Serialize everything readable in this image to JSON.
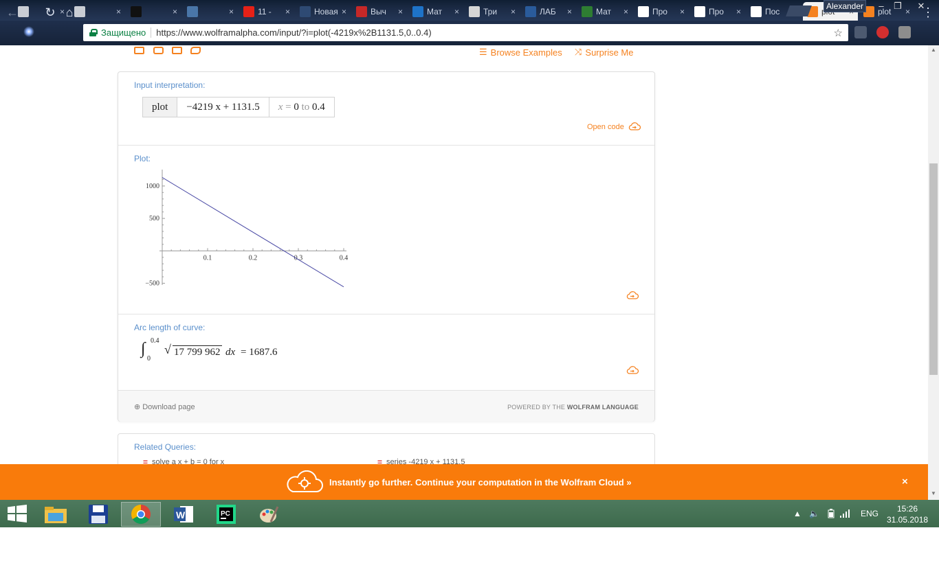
{
  "browser": {
    "tabs": [
      {
        "title": "",
        "color": "#c9cdd4"
      },
      {
        "title": "",
        "color": "#c9cdd4"
      },
      {
        "title": "",
        "color": "#111111"
      },
      {
        "title": "",
        "color": "#4a76a8"
      },
      {
        "title": "11 -",
        "color": "#e62117"
      },
      {
        "title": "Новая в",
        "color": "#2e4a73"
      },
      {
        "title": "Выч",
        "color": "#c62828"
      },
      {
        "title": "Мат",
        "color": "#1e73c8"
      },
      {
        "title": "Три",
        "color": "#d6d6d6"
      },
      {
        "title": "ЛАБ",
        "color": "#2a5b9b"
      },
      {
        "title": "Мат",
        "color": "#2e7d32"
      },
      {
        "title": "Про",
        "color": "#ffffff"
      },
      {
        "title": "Про",
        "color": "#ffffff"
      },
      {
        "title": "Пос",
        "color": "#ffffff"
      },
      {
        "title": "plot",
        "color": "#f58220"
      },
      {
        "title": "plot",
        "color": "#f58220"
      }
    ],
    "user": "Alexander",
    "secure_label": "Защищено",
    "url": "https://www.wolframalpha.com/input/?i=plot(-4219x%2B1131.5,0..0.4)"
  },
  "toolbar": {
    "browse_examples": "Browse Examples",
    "surprise_me": "Surprise Me"
  },
  "input_pod": {
    "title": "Input interpretation:",
    "head": "plot",
    "expr": "−4219 x + 1131.5",
    "range_var": "x",
    "range_eq": "=",
    "range_from": "0",
    "range_to_word": "to",
    "range_to": "0.4",
    "open_code": "Open code"
  },
  "plot_pod": {
    "title": "Plot:"
  },
  "chart_data": {
    "type": "line",
    "title": "",
    "xlabel": "",
    "ylabel": "",
    "xlim": [
      0,
      0.4
    ],
    "ylim": [
      -600,
      1200
    ],
    "x_ticks": [
      0.1,
      0.2,
      0.3,
      0.4
    ],
    "y_ticks": [
      1000,
      500,
      -500
    ],
    "x_tick_labels": [
      "0.1",
      "0.2",
      "0.3",
      "0.4"
    ],
    "y_tick_labels": [
      "1000",
      "500",
      "−500"
    ],
    "series": [
      {
        "x": [
          0,
          0.4
        ],
        "y": [
          1131.5,
          -556.1
        ],
        "color": "#4a4aa5"
      }
    ],
    "grid": false
  },
  "arc_pod": {
    "title": "Arc length of curve:",
    "upper": "0.4",
    "lower": "0",
    "radicand": "17 799 962",
    "dx": "dx",
    "result": "= 1687.6"
  },
  "footer": {
    "download": "Download page",
    "powered_prefix": "POWERED BY THE",
    "powered_brand": "WOLFRAM LANGUAGE"
  },
  "related": {
    "title": "Related Queries:",
    "items": [
      "solve a x + b = 0 for x",
      "series -4219 x + 1131.5"
    ]
  },
  "banner": {
    "text": "Instantly go further. Continue your computation in the Wolfram Cloud »",
    "close": "×"
  },
  "taskbar": {
    "lang": "ENG",
    "time": "15:26",
    "date": "31.05.2018"
  },
  "colors": {
    "accent": "#f58220",
    "pod_title": "#5a8fcb",
    "banner": "#f97b0b",
    "plot_line": "#4a4aa5"
  }
}
